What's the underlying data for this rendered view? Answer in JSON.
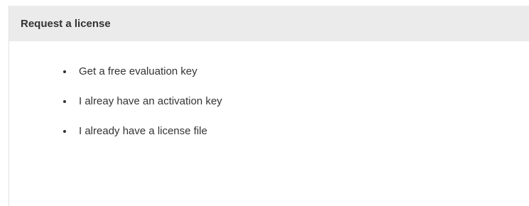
{
  "panel": {
    "title": "Request a license",
    "options": [
      {
        "label": "Get a free evaluation key"
      },
      {
        "label": "I alreay have an activation key"
      },
      {
        "label": "I already have a license file"
      }
    ]
  }
}
